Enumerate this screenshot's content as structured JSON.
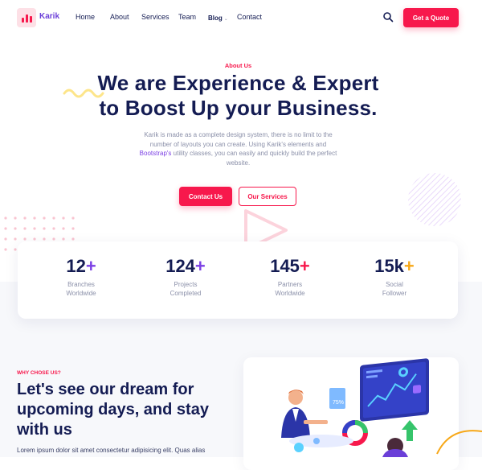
{
  "header": {
    "brand": "Karik",
    "nav": [
      "Home",
      "About",
      "Services",
      "Team",
      "Blog",
      "Contact"
    ],
    "cta": "Get a Quote"
  },
  "hero": {
    "eyebrow": "About Us",
    "title_line1": "We are Experience & Expert",
    "title_line2": "to Boost Up your Business.",
    "desc_line1": "Karik is made as a complete design system, there is no limit to the",
    "desc_line2": "number of layouts you can create. Using Karik's elements and",
    "desc_link": "Bootstrap's",
    "desc_line3_rest": " utility classes, you can easily and quickly build the perfect",
    "desc_line4": "website.",
    "primary_button": "Contact Us",
    "secondary_button": "Our Services"
  },
  "stats": [
    {
      "value": "12",
      "plus": "+",
      "plus_color": "#7b3fe4",
      "line1": "Branches",
      "line2": "Worldwide"
    },
    {
      "value": "124",
      "plus": "+",
      "plus_color": "#7b3fe4",
      "line1": "Projects",
      "line2": "Completed"
    },
    {
      "value": "145",
      "plus": "+",
      "plus_color": "#f7184c",
      "line1": "Partners",
      "line2": "Worldwide"
    },
    {
      "value": "15k",
      "plus": "+",
      "plus_color": "#f7a818",
      "line1": "Social",
      "line2": "Follower"
    }
  ],
  "why": {
    "eyebrow": "WHY CHOSE US?",
    "title_line1": "Let's see our dream for",
    "title_line2": "upcoming days, and stay",
    "title_line3": "with us",
    "text": "Lorem ipsum dolor sit amet consectetur adipisicing elit. Quas alias"
  },
  "illustration": {
    "badge": "75%"
  },
  "colors": {
    "accent": "#f7184c",
    "purple": "#7b3fe4",
    "navy": "#141c53",
    "muted": "#8b90a9"
  },
  "icons": [
    "search-icon",
    "logo-chart-icon",
    "chevron-down-icon",
    "play-triangle-decoration"
  ]
}
